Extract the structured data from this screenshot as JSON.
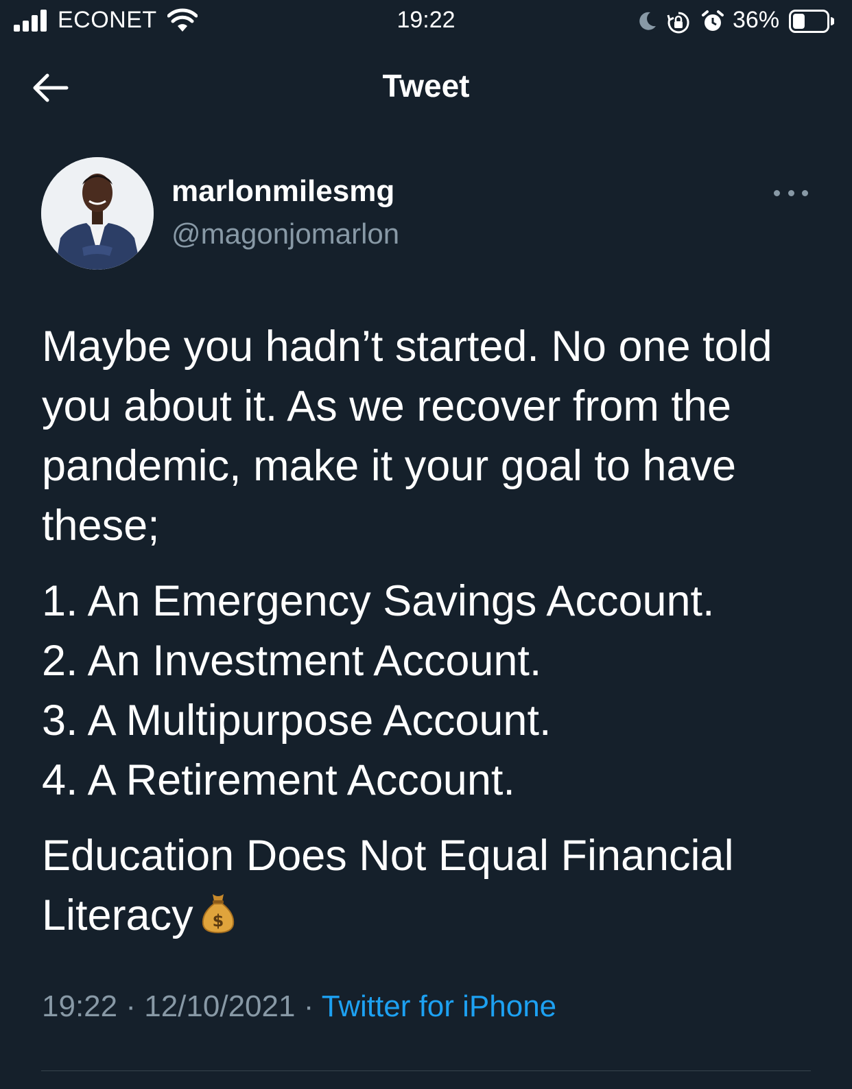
{
  "status_bar": {
    "carrier": "ECONET",
    "time": "19:22",
    "battery_percent": "36%",
    "battery_level": 0.36,
    "icons": [
      "signal-icon",
      "wifi-icon",
      "moon-icon",
      "orientation-lock-icon",
      "alarm-icon",
      "battery-icon"
    ]
  },
  "nav": {
    "back_icon": "arrow-left-icon",
    "title": "Tweet"
  },
  "tweet": {
    "display_name": "marlonmilesmg",
    "handle": "@magonjomarlon",
    "more_icon": "more-dots-icon",
    "intro": "Maybe you hadn’t started. No one told you about it. As we recover from the pandemic, make it your goal to have these;",
    "list": [
      "1. An Emergency Savings Account.",
      "2. An Investment Account.",
      "3. A Multipurpose Account.",
      "4. A Retirement Account."
    ],
    "closing": "Education Does Not Equal Financial Literacy",
    "closing_emoji": "money-bag-icon",
    "time": "19:22",
    "separator": "·",
    "date": "12/10/2021",
    "source": "Twitter for iPhone"
  },
  "colors": {
    "background": "#15202b",
    "text": "#ffffff",
    "secondary_text": "#8899a6",
    "link": "#1da1f2",
    "divider": "#38444d"
  }
}
